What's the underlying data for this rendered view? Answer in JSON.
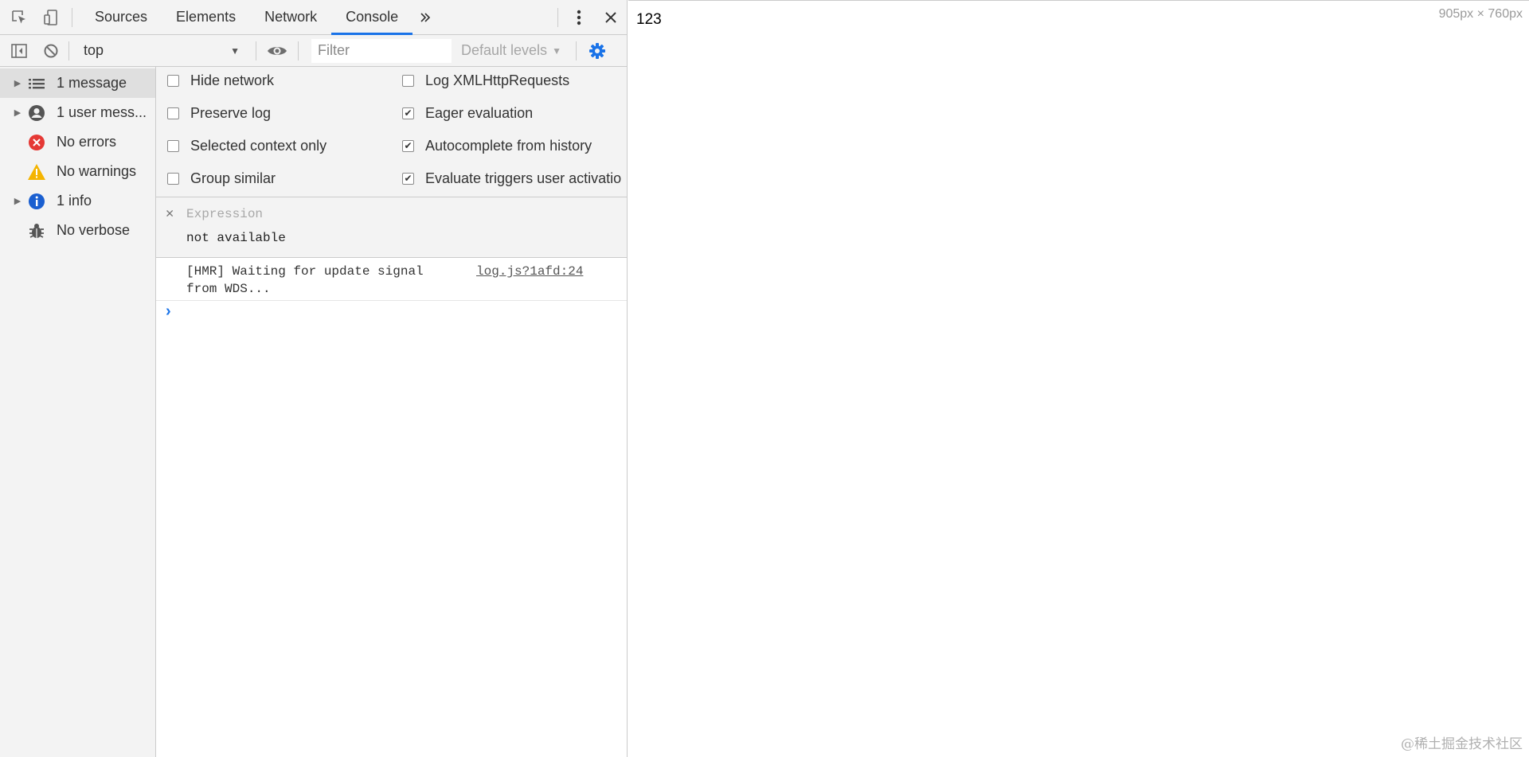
{
  "devtools": {
    "tabs": [
      {
        "label": "Sources"
      },
      {
        "label": "Elements"
      },
      {
        "label": "Network"
      },
      {
        "label": "Console",
        "active": true
      }
    ],
    "more_tabs_icon": "chevron-double-right-icon",
    "toolbar": {
      "context": "top",
      "filter_placeholder": "Filter",
      "levels": "Default levels"
    },
    "sidebar": {
      "items": [
        {
          "label": "1 message",
          "icon": "list-icon",
          "expandable": true,
          "selected": true
        },
        {
          "label": "1 user mess...",
          "icon": "user-icon",
          "expandable": true
        },
        {
          "label": "No errors",
          "icon": "error-icon",
          "expandable": false
        },
        {
          "label": "No warnings",
          "icon": "warning-icon",
          "expandable": false
        },
        {
          "label": "1 info",
          "icon": "info-icon",
          "expandable": true
        },
        {
          "label": "No verbose",
          "icon": "bug-icon",
          "expandable": false
        }
      ]
    },
    "settings": {
      "left": [
        {
          "label": "Hide network",
          "checked": false
        },
        {
          "label": "Preserve log",
          "checked": false
        },
        {
          "label": "Selected context only",
          "checked": false
        },
        {
          "label": "Group similar",
          "checked": false
        }
      ],
      "right": [
        {
          "label": "Log XMLHttpRequests",
          "checked": false
        },
        {
          "label": "Eager evaluation",
          "checked": true
        },
        {
          "label": "Autocomplete from history",
          "checked": true
        },
        {
          "label": "Evaluate triggers user activatio",
          "checked": true
        }
      ]
    },
    "expression": {
      "placeholder": "Expression",
      "value": "not available"
    },
    "messages": [
      {
        "text_line1": "[HMR] Waiting for update signal",
        "text_line2": "from WDS...",
        "source": "log.js?1afd:24"
      }
    ]
  },
  "page": {
    "text": "123",
    "dimensions": "905px × 760px",
    "watermark": "@稀土掘金技术社区"
  },
  "colors": {
    "accent": "#1a73e8",
    "error": "#e53935",
    "warning": "#f4b400",
    "info": "#1a73e8",
    "toolbar_bg": "#f3f3f3"
  }
}
